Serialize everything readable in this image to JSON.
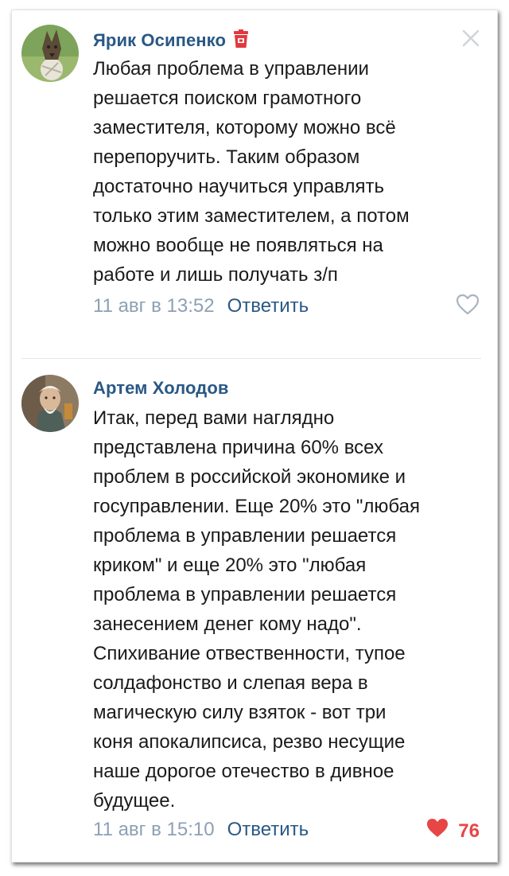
{
  "comments": [
    {
      "author": "Ярик Осипенко",
      "text_lines": [
        "Любая проблема в управлении",
        "решается поиском грамотного",
        "заместителя, которому можно всё",
        "перепоручить. Таким образом",
        "достаточно научиться управлять",
        "только этим заместителем, а потом",
        "можно вообще не появляться на",
        "работе и лишь получать з/п"
      ],
      "date": "11 авг в 13:52",
      "reply_label": "Ответить",
      "likes": "",
      "liked": false
    },
    {
      "author": "Артем Холодов",
      "text_lines": [
        "Итак, перед вами наглядно",
        "представлена причина 60% всех",
        "проблем в российской экономике и",
        "госуправлении. Еще 20% это \"любая",
        "проблема в управлении решается",
        "криком\" и еще 20% это \"любая",
        "проблема в управлении решается",
        "занесением денег кому надо\".",
        "Спихивание отвественности, тупое",
        "солдафонство и слепая вера в",
        "магическую силу взяток - вот три",
        "коня апокалипсиса, резво несущие",
        "наше дорогое отечество в дивное",
        "будущее."
      ],
      "date": "11 авг в 15:10",
      "reply_label": "Ответить",
      "likes": "76",
      "liked": true
    }
  ],
  "icons": {
    "badge": "trash-can-icon",
    "close": "close-icon",
    "like_empty": "heart-outline-icon",
    "like_filled": "heart-filled-icon"
  },
  "colors": {
    "author": "#2a5885",
    "meta": "#8da0b5",
    "like": "#e64646",
    "badge": "#e0393e"
  }
}
